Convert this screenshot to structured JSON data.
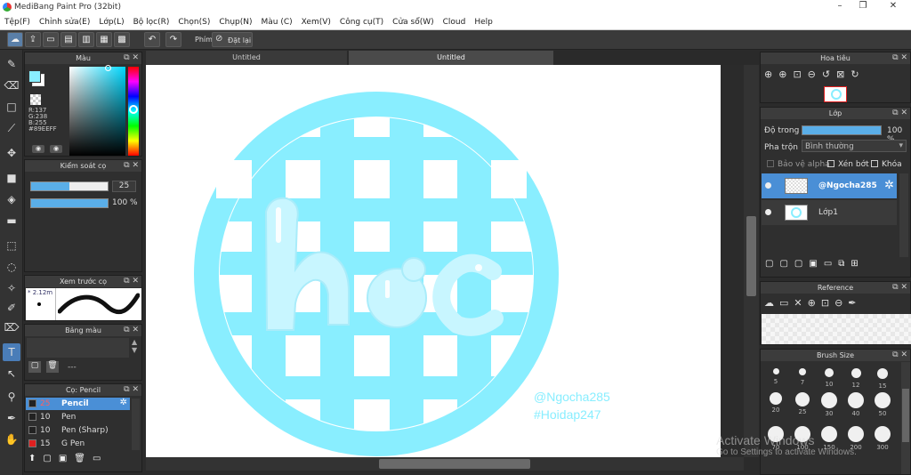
{
  "window": {
    "title": "MediBang Paint Pro (32bit)",
    "minimize": "–",
    "maximize": "❐",
    "close": "✕"
  },
  "menu": [
    "Tệp(F)",
    "Chỉnh sửa(E)",
    "Lớp(L)",
    "Bộ lọc(R)",
    "Chọn(S)",
    "Chụp(N)",
    "Màu (C)",
    "Xem(V)",
    "Công cụ(T)",
    "Cửa sổ(W)",
    "Cloud",
    "Help"
  ],
  "toolbar": {
    "shortcut_label": "Phím",
    "reset_label": "Đặt lại"
  },
  "tabs": [
    "Untitled",
    "Untitled"
  ],
  "color_panel": {
    "title": "Màu",
    "r": "R:137",
    "g": "G:238",
    "b": "B:255",
    "hex": "#89EEFF",
    "fg": "#89eeff",
    "bg": "#ffffff"
  },
  "brush_control": {
    "title": "Kiểm soát cọ",
    "size": "25",
    "opacity": "100 %",
    "size_fraction": 0.5,
    "opacity_fraction": 1.0
  },
  "brush_preview": {
    "title": "Xem trước cọ",
    "size_text": "* 2.12m"
  },
  "palette": {
    "title": "Bảng màu",
    "label": "---"
  },
  "brush_list": {
    "title": "Cọ: Pencil",
    "items": [
      {
        "size": "25",
        "name": "Pencil",
        "color": "#222222",
        "selected": true
      },
      {
        "size": "10",
        "name": "Pen",
        "color": "#222222",
        "selected": false
      },
      {
        "size": "10",
        "name": "Pen (Sharp)",
        "color": "#222222",
        "selected": false
      },
      {
        "size": "15",
        "name": "G Pen",
        "color": "#e02020",
        "selected": false
      }
    ]
  },
  "artwork": {
    "main_color": "#89eeff",
    "letters_color": "#c8f6ff",
    "word": "học",
    "watermark_1": "@Ngocha285",
    "watermark_2": "#Hoidap247"
  },
  "navigator": {
    "title": "Hoa tiêu"
  },
  "layers": {
    "title": "Lớp",
    "opacity_label": "Độ trong",
    "opacity_value": "100 %",
    "blend_label": "Pha trộn",
    "blend_value": "Bình thường",
    "alpha_protect": "Bảo vệ alpha",
    "clipping": "Xén bớt",
    "lock": "Khóa",
    "items": [
      {
        "name": "@Ngocha285",
        "selected": true
      },
      {
        "name": "Lớp1",
        "selected": false
      }
    ]
  },
  "reference": {
    "title": "Reference"
  },
  "brush_size": {
    "title": "Brush Size",
    "sizes": [
      "5",
      "7",
      "10",
      "12",
      "15",
      "20",
      "25",
      "30",
      "40",
      "50",
      "70",
      "100",
      "150",
      "200",
      "300"
    ]
  },
  "activation": {
    "line1": "Activate Windows",
    "line2": "Go to Settings to activate Windows."
  }
}
